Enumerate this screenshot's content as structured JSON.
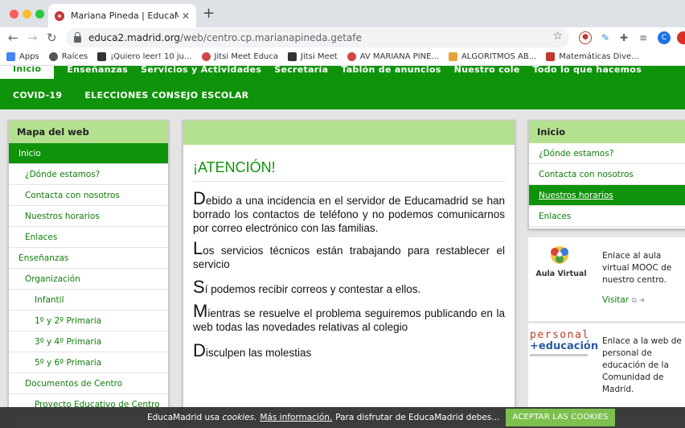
{
  "browser": {
    "tab_title": "Mariana Pineda | EducaMadrid",
    "url_host": "educa2.madrid.org",
    "url_path": "/web/centro.cp.marianapineda.getafe",
    "profile_initial": "C",
    "bookmarks": [
      {
        "label": "Apps",
        "icon": "apps-grid-icon",
        "color": "#4285f4"
      },
      {
        "label": "Raíces",
        "icon": "globe-icon",
        "color": "#555555"
      },
      {
        "label": "¡Quiero leer! 10 ju...",
        "icon": "book-icon",
        "color": "#333333"
      },
      {
        "label": "Jitsi Meet Educa",
        "icon": "educamadrid-icon",
        "color": "#d04747"
      },
      {
        "label": "Jitsi Meet",
        "icon": "feather-icon",
        "color": "#333333"
      },
      {
        "label": "AV MARIANA PINE...",
        "icon": "educamadrid-icon",
        "color": "#d04747"
      },
      {
        "label": "ALGORITMOS AB...",
        "icon": "algoritmos-icon",
        "color": "#e6a33a"
      },
      {
        "label": "Matemáticas Dive...",
        "icon": "math-icon",
        "color": "#c0392b"
      }
    ]
  },
  "nav": {
    "row1": [
      "Inicio",
      "Enseñanzas",
      "Servicios y Actividades",
      "Secretaría",
      "Tablón de anuncios",
      "Nuestro cole",
      "Todo lo que hacemos"
    ],
    "row2": [
      "COVID-19",
      "ELECCIONES CONSEJO ESCOLAR"
    ]
  },
  "left_panel": {
    "title": "Mapa del web",
    "items": [
      {
        "label": "Inicio",
        "level": 1
      },
      {
        "label": "¿Dónde estamos?",
        "level": 2
      },
      {
        "label": "Contacta con nosotros",
        "level": 2
      },
      {
        "label": "Nuestros horarios",
        "level": 2
      },
      {
        "label": "Enlaces",
        "level": 2
      },
      {
        "label": "Enseñanzas",
        "level": 1
      },
      {
        "label": "Organización",
        "level": 2
      },
      {
        "label": "Infantil",
        "level": 3
      },
      {
        "label": "1º y 2º Primaria",
        "level": 3
      },
      {
        "label": "3º y 4º Primaria",
        "level": 3
      },
      {
        "label": "5º y 6º Primaria",
        "level": 3
      },
      {
        "label": "Documentos de Centro",
        "level": 2
      },
      {
        "label": "Proyecto Educativo de Centro",
        "level": 3
      }
    ]
  },
  "center": {
    "title": "¡ATENCIÓN!",
    "paragraphs": [
      {
        "cap": "D",
        "text": "ebido a una incidencia en el servidor de Educamadrid se han borrado los contactos de teléfono y no podemos comunicarnos por correo electrónico con las familias."
      },
      {
        "cap": "L",
        "text": "os servicios técnicos están trabajando para restablecer el servicio"
      },
      {
        "cap": "S",
        "text": "í podemos recibir correos y contestar a ellos."
      },
      {
        "cap": "M",
        "text": "ientras se resuelve el problema seguiremos publicando en la web todas las novedades relativas al colegio"
      },
      {
        "cap": "D",
        "text": "isculpen las molestias"
      }
    ]
  },
  "right_panel": {
    "title": "Inicio",
    "items": [
      "¿Dónde estamos?",
      "Contacta con nosotros",
      "Nuestros horarios",
      "Enlaces"
    ]
  },
  "aula_virtual": {
    "logo_text": "Aula Virtual",
    "text": "Enlace al aula virtual MOOC de nuestro centro.",
    "link": "Visitar"
  },
  "personal_educacion": {
    "logo_line1": "personal",
    "logo_line2": "+educación",
    "text": "Enlace a la web de personal de educación de la Comunidad de Madrid."
  },
  "cookie": {
    "prefix": "EducaMadrid usa",
    "emph": "cookies.",
    "link": "Más información.",
    "suffix": "Para disfrutar de EducaMadrid debes...",
    "button": "ACEPTAR LAS COOKIES"
  },
  "colors": {
    "green": "#0f930b",
    "light_green": "#b4e190"
  }
}
